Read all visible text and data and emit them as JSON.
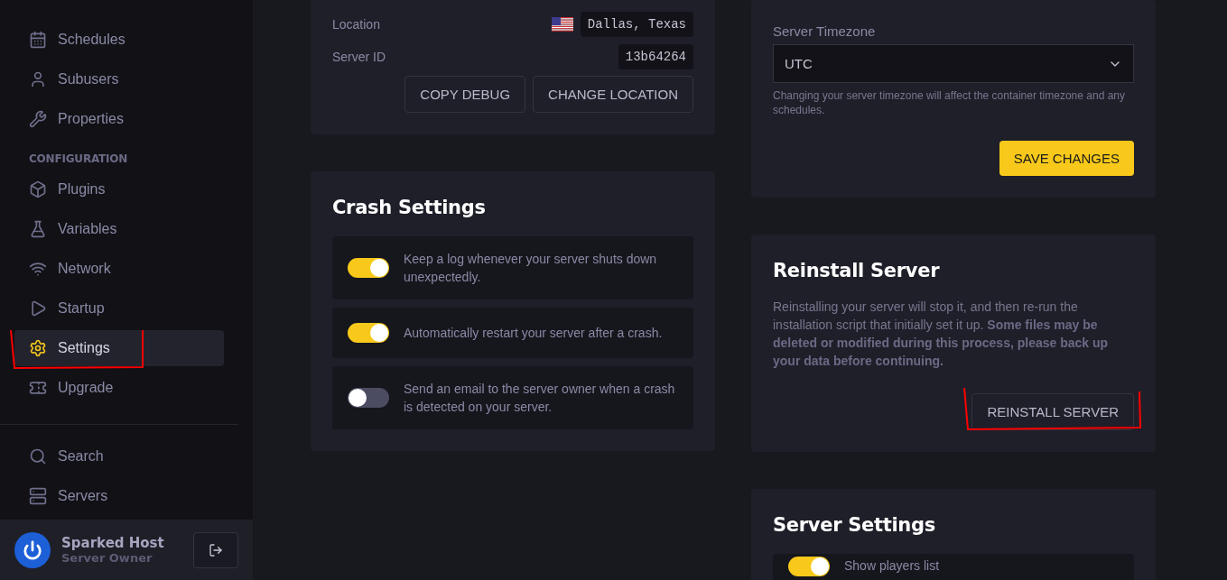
{
  "sidebar": {
    "sections": [
      {
        "items": [
          {
            "label": "Schedules",
            "selected": false,
            "annotated": false
          },
          {
            "label": "Subusers",
            "selected": false,
            "annotated": false
          },
          {
            "label": "Properties",
            "selected": false,
            "annotated": false
          }
        ]
      },
      {
        "heading": "CONFIGURATION",
        "items": [
          {
            "label": "Plugins",
            "selected": false,
            "annotated": false
          },
          {
            "label": "Variables",
            "selected": false,
            "annotated": false
          },
          {
            "label": "Network",
            "selected": false,
            "annotated": false
          },
          {
            "label": "Startup",
            "selected": false,
            "annotated": false
          },
          {
            "label": "Settings",
            "selected": true,
            "annotated": true
          },
          {
            "label": "Upgrade",
            "selected": false,
            "annotated": false
          }
        ]
      },
      {
        "items": [
          {
            "label": "Search",
            "selected": false,
            "annotated": false
          },
          {
            "label": "Servers",
            "selected": false,
            "annotated": false
          }
        ]
      }
    ],
    "user": {
      "name": "Sparked Host",
      "role": "Server Owner"
    }
  },
  "debug_card": {
    "rows": [
      {
        "label": "Location",
        "value": "Dallas, Texas",
        "flag": true
      },
      {
        "label": "Server ID",
        "value": "13b64264"
      }
    ],
    "buttons": [
      "COPY DEBUG",
      "CHANGE LOCATION"
    ]
  },
  "crash_settings": {
    "title": "Crash Settings",
    "toggles": [
      {
        "label": "Keep a log whenever your server shuts down unexpectedly.",
        "on": true
      },
      {
        "label": "Automatically restart your server after a crash.",
        "on": true
      },
      {
        "label": "Send an email to the server owner when a crash is detected on your server.",
        "on": false
      }
    ]
  },
  "timezone_card": {
    "label": "Server Timezone",
    "value": "UTC",
    "help": "Changing your server timezone will affect the container timezone and any schedules.",
    "button": "SAVE CHANGES"
  },
  "reinstall_card": {
    "title": "Reinstall Server",
    "text": "Reinstalling your server will stop it, and then re-run the installation script that initially set it up. **Some files may be deleted or modified during this process, please back up your data before continuing.**",
    "button": {
      "label": "REINSTALL SERVER",
      "annotated": true
    }
  },
  "server_settings": {
    "title": "Server Settings",
    "toggles": [
      {
        "label": "Show players list",
        "on": true
      }
    ]
  }
}
